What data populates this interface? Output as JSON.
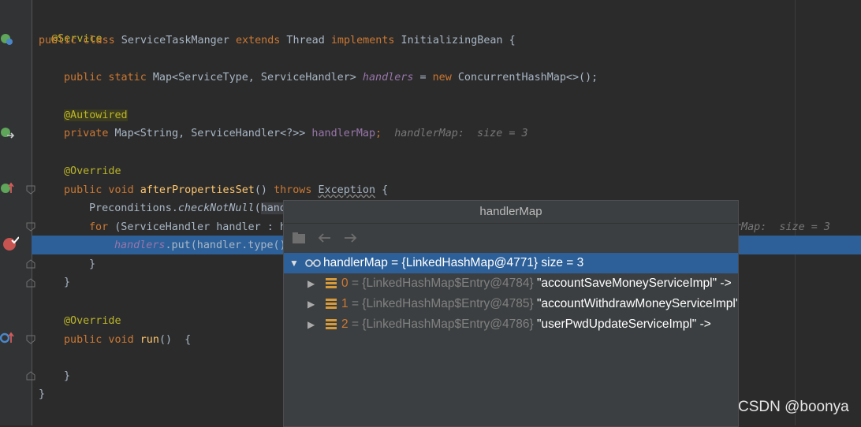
{
  "code": {
    "l1": "@Service",
    "l2_kw1": "public class",
    "l2_name": " ServiceTaskManger ",
    "l2_kw2": "extends",
    "l2_t": " Thread ",
    "l2_kw3": "implements",
    "l2_i": " InitializingBean {",
    "l3_kw": "public static",
    "l3_t": " Map<ServiceType, ServiceHandler> ",
    "l3_f": "handlers",
    "l3_eq": " = ",
    "l3_new": "new",
    "l3_rest": " ConcurrentHashMap<>();",
    "l4_ann": "@Autowired",
    "l5_kw": "private",
    "l5_t": " Map<String, ServiceHandler<?>> ",
    "l5_f": "handlerMap",
    "l5_semi": ";",
    "l5_hint": "  handlerMap:  size = 3",
    "l6_ann": "@Override",
    "l7_kw": "public void",
    "l7_m": " afterPropertiesSet",
    "l7_p": "() ",
    "l7_throws": "throws",
    "l7_exc": "Exception",
    "l7_brace": " {",
    "l8_a": "Preconditions.",
    "l8_m": "checkNotNull",
    "l8_p": "(",
    "l8_arg": "hand",
    "l9_for": "for",
    "l9_rest": " (ServiceHandler handler : h",
    "l9_hint": "rMap:  size = 3",
    "l10_f": "handlers",
    "l10_rest": ".put(handler.type()",
    "l11": "}",
    "l12": "}",
    "l13_ann": "@Override",
    "l14_kw": "public void",
    "l14_m": " run",
    "l14_rest": "()  {",
    "l15": "}",
    "l16": "}"
  },
  "popup": {
    "title": "handlerMap",
    "root": {
      "label": "handlerMap = {LinkedHashMap@4771}  size = 3"
    },
    "entries": [
      {
        "index": "0",
        "type": "= {LinkedHashMap$Entry@4784}",
        "value": "\"accountSaveMoneyServiceImpl\" ->"
      },
      {
        "index": "1",
        "type": "= {LinkedHashMap$Entry@4785}",
        "value": "\"accountWithdrawMoneyServiceImpl\" ->"
      },
      {
        "index": "2",
        "type": "= {LinkedHashMap$Entry@4786}",
        "value": "\"userPwdUpdateServiceImpl\" ->"
      }
    ]
  },
  "watermark": "CSDN @boonya",
  "colors": {
    "background": "#2b2b2b",
    "selection": "#2d6099",
    "keyword": "#cc7832",
    "annotation": "#bbb529",
    "field": "#9876aa",
    "method": "#ffc66d"
  }
}
